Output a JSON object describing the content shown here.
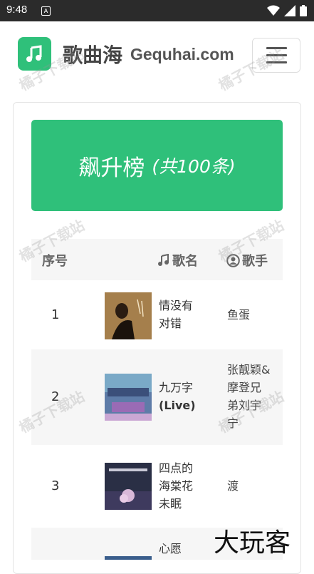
{
  "status_bar": {
    "time": "9:48",
    "notification_badge": "A"
  },
  "header": {
    "logo_icon": "music-note-icon",
    "brand_cn": "歌曲海",
    "brand_en": "Gequhai.com",
    "menu_icon": "hamburger-icon"
  },
  "banner": {
    "title": "飙升榜",
    "count": "(共100条)"
  },
  "table": {
    "col_index": "序号",
    "col_song": "歌名",
    "col_artist": "歌手",
    "rows": [
      {
        "index": "1",
        "song_lines": [
          "情没有",
          "对错"
        ],
        "artist_lines": [
          "鱼蛋"
        ]
      },
      {
        "index": "2",
        "song_lines": [
          "九万字",
          "(Live)"
        ],
        "artist_lines": [
          "张靓颖&",
          "摩登兄",
          "弟刘宇",
          "宁"
        ]
      },
      {
        "index": "3",
        "song_lines": [
          "四点的",
          "海棠花",
          "未眠"
        ],
        "artist_lines": [
          "渡"
        ]
      },
      {
        "index": "",
        "song_lines": [
          "心愿"
        ],
        "artist_lines": []
      }
    ]
  },
  "watermarks": {
    "site": "橘子下载站",
    "corner": "大玩客"
  },
  "colors": {
    "accent": "#2fc07a",
    "status_bar": "#2b2b2b",
    "row_shade": "#f6f6f6"
  }
}
